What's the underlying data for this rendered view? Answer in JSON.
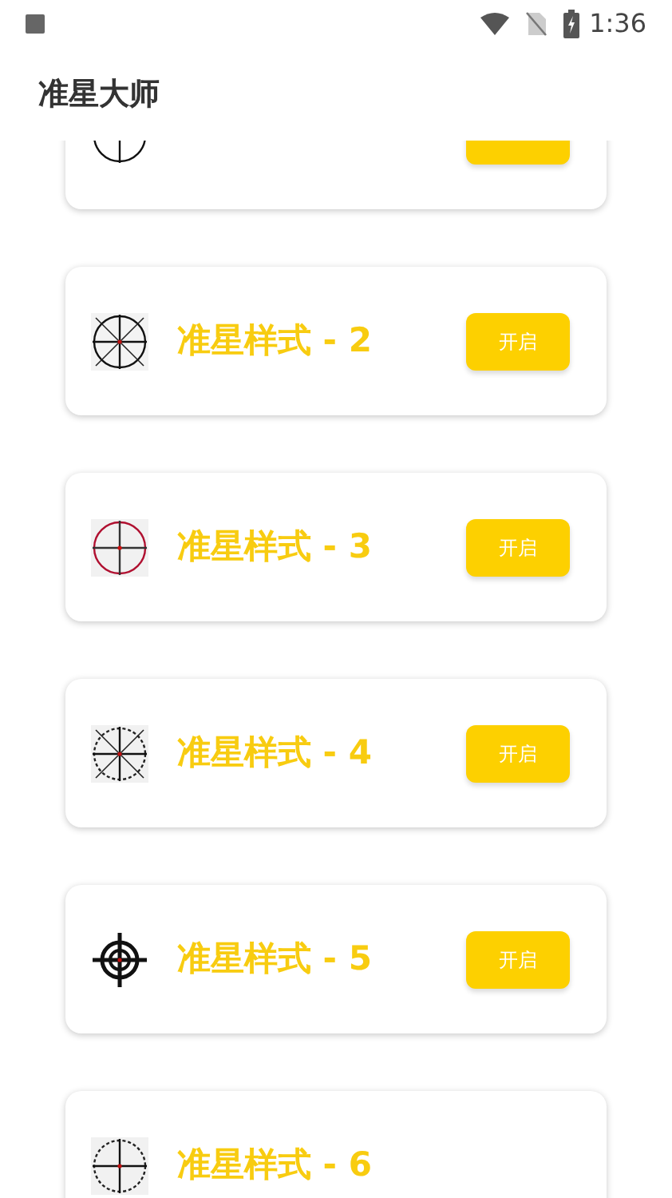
{
  "status_bar": {
    "time": "1:36"
  },
  "app_bar": {
    "title": "准星大师"
  },
  "cards": [
    {
      "kind": "plain",
      "has_button": true
    },
    {
      "kind": "cross-x",
      "title": "准星样式 - 2",
      "button": "开启"
    },
    {
      "kind": "red",
      "title": "准星样式 - 3",
      "button": "开启"
    },
    {
      "kind": "dotted",
      "title": "准星样式 - 4",
      "button": "开启"
    },
    {
      "kind": "ring",
      "title": "准星样式 - 5",
      "button": "开启"
    },
    {
      "kind": "fine",
      "title": "准星样式 - 6"
    }
  ]
}
